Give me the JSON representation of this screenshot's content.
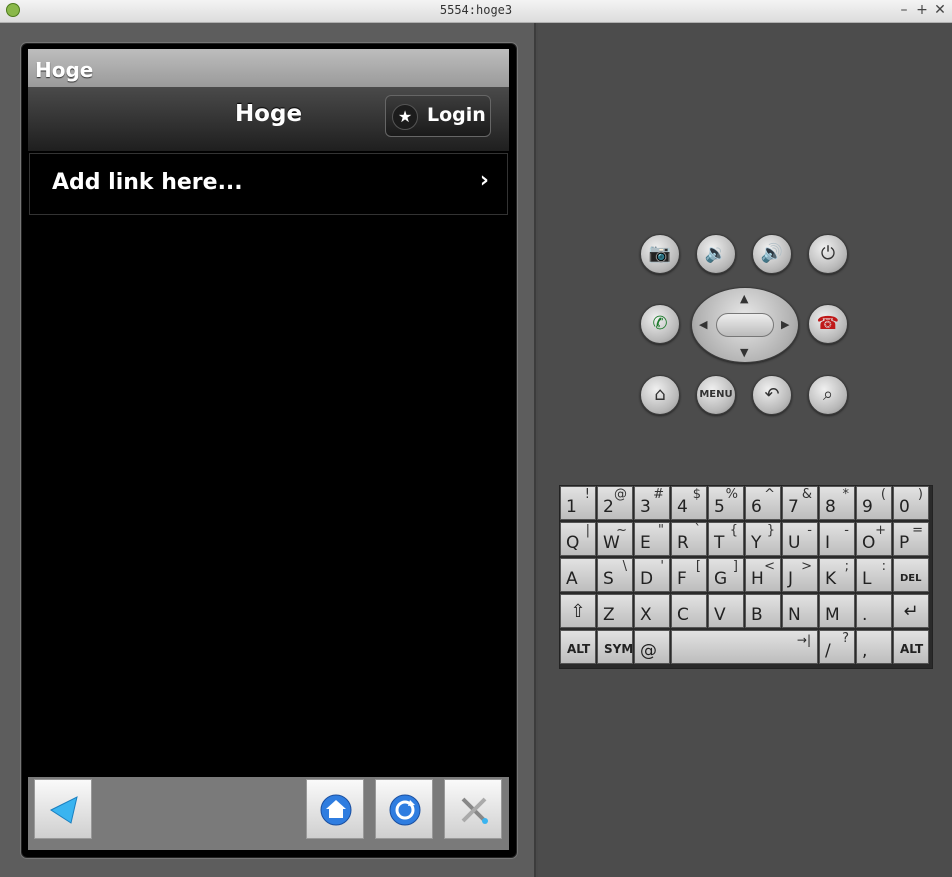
{
  "window": {
    "title": "5554:hoge3",
    "buttons": [
      "–",
      "+",
      "✕"
    ]
  },
  "app": {
    "status_title": "Hoge",
    "header_title": "Hoge",
    "login_label": "Login",
    "list_item": "Add link here..."
  },
  "controls": {
    "hardware_buttons": [
      "camera",
      "volume-down",
      "volume-up",
      "power",
      "call",
      "end-call",
      "home",
      "menu",
      "back",
      "search"
    ],
    "menu_label": "MENU"
  },
  "keyboard": {
    "rows": [
      [
        [
          "1",
          "!"
        ],
        [
          "2",
          "@"
        ],
        [
          "3",
          "#"
        ],
        [
          "4",
          "$"
        ],
        [
          "5",
          "%"
        ],
        [
          "6",
          "^"
        ],
        [
          "7",
          "&"
        ],
        [
          "8",
          "*"
        ],
        [
          "9",
          "("
        ],
        [
          "0",
          ")"
        ]
      ],
      [
        [
          "Q",
          "|"
        ],
        [
          "W",
          "~"
        ],
        [
          "E",
          "\""
        ],
        [
          "R",
          "`"
        ],
        [
          "T",
          "{"
        ],
        [
          "Y",
          "}"
        ],
        [
          "U",
          "-"
        ],
        [
          "I",
          "-"
        ],
        [
          "O",
          "+"
        ],
        [
          "P",
          "="
        ]
      ],
      [
        [
          "A",
          ""
        ],
        [
          "S",
          "\\"
        ],
        [
          "D",
          "'"
        ],
        [
          "F",
          "["
        ],
        [
          "G",
          "]"
        ],
        [
          "H",
          "<"
        ],
        [
          "J",
          ">"
        ],
        [
          "K",
          ";"
        ],
        [
          "L",
          ":"
        ],
        [
          "DEL",
          ""
        ]
      ],
      [
        [
          "⇧",
          ""
        ],
        [
          "Z",
          ""
        ],
        [
          "X",
          ""
        ],
        [
          "C",
          ""
        ],
        [
          "V",
          ""
        ],
        [
          "B",
          ""
        ],
        [
          "N",
          ""
        ],
        [
          "M",
          ""
        ],
        [
          ".",
          ""
        ],
        [
          "↵",
          ""
        ]
      ]
    ],
    "bottom": {
      "alt_left": "ALT",
      "sym": "SYM",
      "at": "@",
      "space_hint": "→|",
      "slash": "/",
      "question": "?",
      "comma": ",",
      "alt_right": "ALT"
    }
  }
}
